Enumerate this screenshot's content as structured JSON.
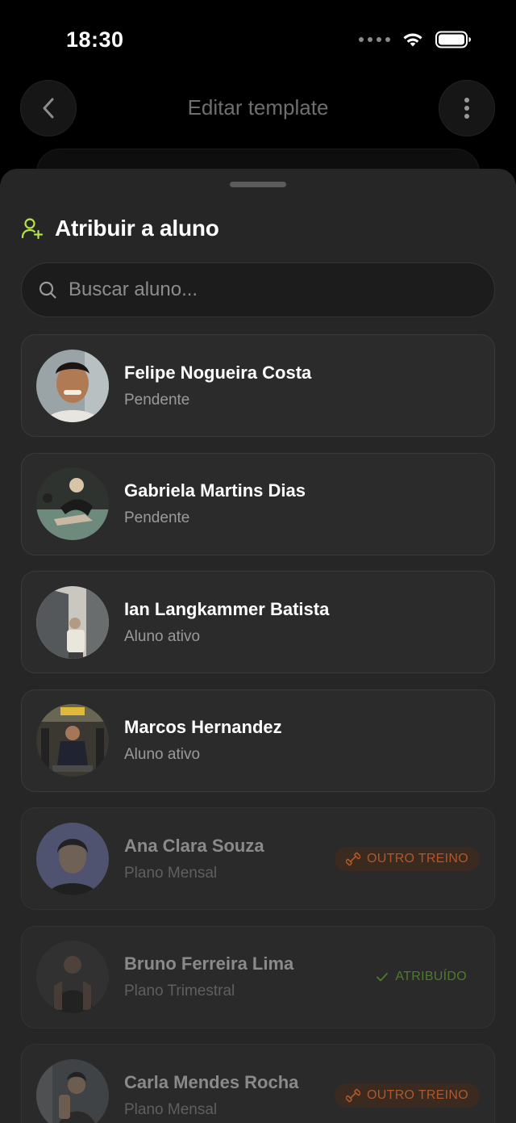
{
  "status_bar": {
    "time": "18:30"
  },
  "background": {
    "title": "Editar template"
  },
  "sheet": {
    "title": "Atribuir a aluno",
    "search_placeholder": "Buscar aluno...",
    "students": [
      {
        "name": "Felipe Nogueira Costa",
        "status": "Pendente",
        "badge": "",
        "dim": false
      },
      {
        "name": "Gabriela Martins Dias",
        "status": "Pendente",
        "badge": "",
        "dim": false
      },
      {
        "name": "Ian Langkammer Batista",
        "status": "Aluno ativo",
        "badge": "",
        "dim": false
      },
      {
        "name": "Marcos Hernandez",
        "status": "Aluno ativo",
        "badge": "",
        "dim": false
      },
      {
        "name": "Ana Clara Souza",
        "status": "Plano Mensal",
        "badge": "OUTRO TREINO",
        "dim": true
      },
      {
        "name": "Bruno Ferreira Lima",
        "status": "Plano Trimestral",
        "badge": "ATRIBUÍDO",
        "dim": true
      },
      {
        "name": "Carla Mendes Rocha",
        "status": "Plano Mensal",
        "badge": "OUTRO TREINO",
        "dim": true
      }
    ]
  },
  "colors": {
    "accent": "#b6e34a",
    "other_badge": "#b0582b",
    "assigned_badge": "#4f7a2e"
  }
}
